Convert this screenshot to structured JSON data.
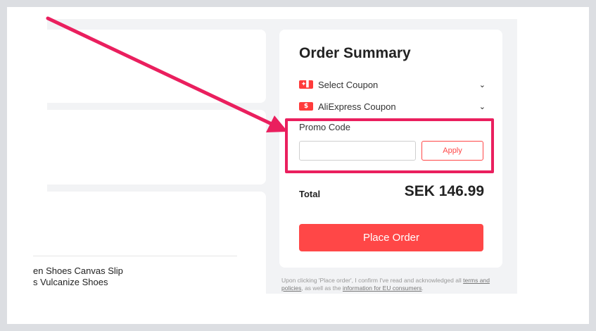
{
  "product": {
    "title_line1": "en Shoes Canvas Slip",
    "title_line2": "s Vulcanize Shoes"
  },
  "summary": {
    "title": "Order Summary",
    "coupons": [
      {
        "icon": "store-coupon-icon",
        "icon_glyph": "✦▌",
        "label": "Select Coupon",
        "chevron": "⌄"
      },
      {
        "icon": "aliexpress-coupon-icon",
        "icon_glyph": "$",
        "label": "AliExpress Coupon",
        "chevron": "⌄"
      }
    ],
    "promo": {
      "label": "Promo Code",
      "value": "",
      "placeholder": "",
      "apply_label": "Apply"
    },
    "total_label": "Total",
    "total_value": "SEK 146.99",
    "place_order_label": "Place Order"
  },
  "legal": {
    "prefix": "Upon clicking 'Place order', I confirm I've read and acknowledged all ",
    "terms_link": "terms and policies",
    "middle": ", as well as the ",
    "eu_link": "information for EU consumers",
    "suffix": "."
  },
  "colors": {
    "accent": "#ff4747",
    "annotation": "#ea1f5e"
  }
}
